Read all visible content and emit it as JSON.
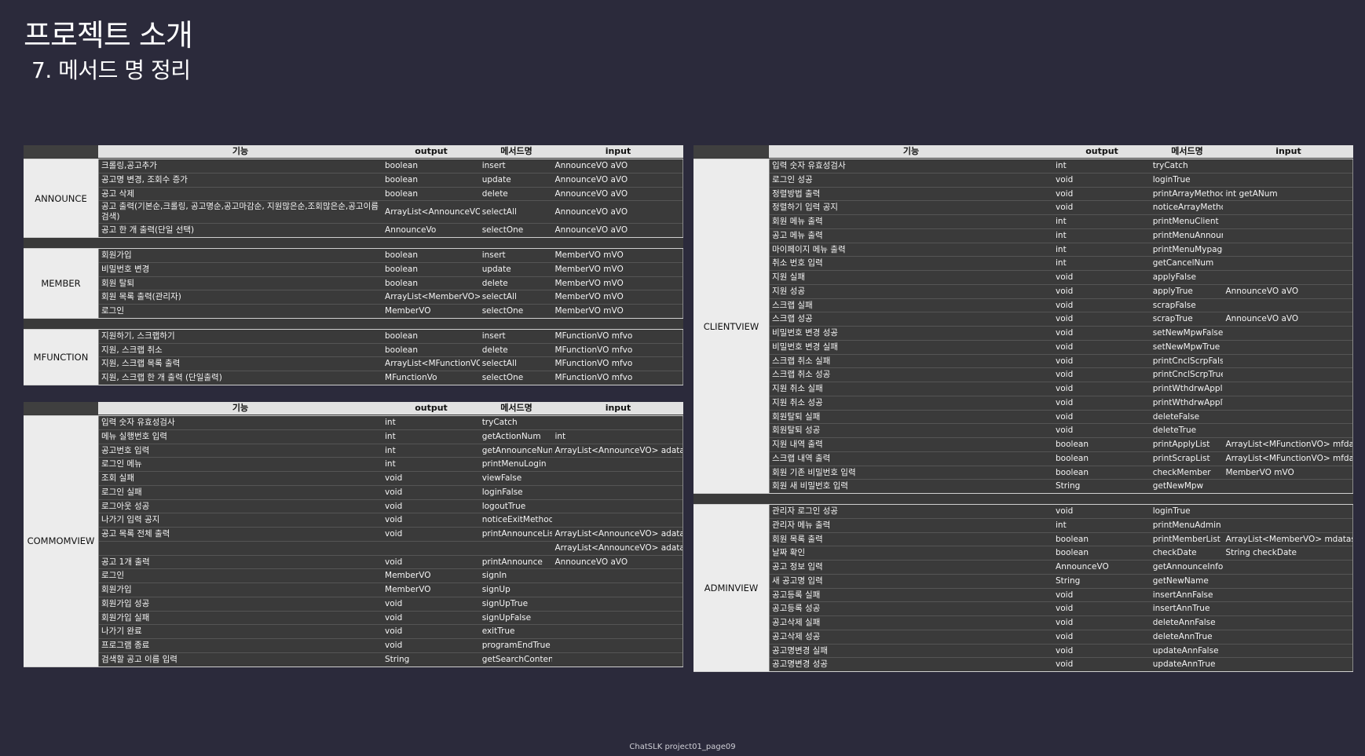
{
  "title": "프로젝트 소개",
  "subtitle": "7. 메서드 명 정리",
  "footer": "ChatSLK project01_page09",
  "headers": {
    "feature": "기능",
    "output": "output",
    "method": "메서드명",
    "input": "input"
  },
  "table1": {
    "announce": {
      "label": "ANNOUNCE",
      "rows": [
        {
          "feature": "크롤링,공고추가",
          "output": "boolean",
          "method": "insert",
          "input": "AnnounceVO aVO"
        },
        {
          "feature": "공고명 변경, 조회수 증가",
          "output": "boolean",
          "method": "update",
          "input": "AnnounceVO aVO"
        },
        {
          "feature": "공고 삭제",
          "output": "boolean",
          "method": "delete",
          "input": "AnnounceVO aVO"
        },
        {
          "feature": "공고 출력(기본순,크롤링, 공고명순,공고마감순, 지원많은순,조회많은순,공고이름검색)",
          "output": "ArrayList<AnnounceVO>",
          "method": "selectAll",
          "input": "AnnounceVO aVO"
        },
        {
          "feature": "공고 한 개 출력(단일 선택)",
          "output": "AnnounceVo",
          "method": "selectOne",
          "input": "AnnounceVO aVO"
        }
      ]
    },
    "member": {
      "label": "MEMBER",
      "rows": [
        {
          "feature": "회원가입",
          "output": "boolean",
          "method": "insert",
          "input": "MemberVO mVO"
        },
        {
          "feature": "비밀번호 변경",
          "output": "boolean",
          "method": "update",
          "input": "MemberVO mVO"
        },
        {
          "feature": "회원 탈퇴",
          "output": "boolean",
          "method": "delete",
          "input": "MemberVO mVO"
        },
        {
          "feature": "회원 목록 출력(관리자)",
          "output": "ArrayList<MemberVO>",
          "method": "selectAll",
          "input": "MemberVO mVO"
        },
        {
          "feature": "로그인",
          "output": "MemberVO",
          "method": "selectOne",
          "input": "MemberVO mVO"
        }
      ]
    },
    "mfunction": {
      "label": "MFUNCTION",
      "rows": [
        {
          "feature": "지원하기, 스크랩하기",
          "output": "boolean",
          "method": "insert",
          "input": "MFunctionVO mfvo"
        },
        {
          "feature": "지원, 스크랩 취소",
          "output": "boolean",
          "method": "delete",
          "input": "MFunctionVO mfvo"
        },
        {
          "feature": "지원, 스크랩 목록 출력",
          "output": "ArrayList<MFunctionVO>",
          "method": "selectAll",
          "input": "MFunctionVO mfvo"
        },
        {
          "feature": "지원, 스크랩 한 개 출력 (단일출력)",
          "output": "MFunctionVo",
          "method": "selectOne",
          "input": "MFunctionVO mfvo"
        }
      ]
    }
  },
  "table2": {
    "commomview": {
      "label": "COMMOMVIEW",
      "rows": [
        {
          "feature": "입력 숫자 유효성검사",
          "output": "int",
          "method": "tryCatch",
          "input": ""
        },
        {
          "feature": "메뉴 실행번호 입력",
          "output": "int",
          "method": "getActionNum",
          "input": "int"
        },
        {
          "feature": "공고번호 입력",
          "output": "int",
          "method": "getAnnounceNum",
          "input": "ArrayList<AnnounceVO> adatas"
        },
        {
          "feature": "로그인 메뉴",
          "output": "int",
          "method": "printMenuLogin",
          "input": ""
        },
        {
          "feature": "조회 실패",
          "output": "void",
          "method": "viewFalse",
          "input": ""
        },
        {
          "feature": "로그인 실패",
          "output": "void",
          "method": "loginFalse",
          "input": ""
        },
        {
          "feature": "로그아웃 성공",
          "output": "void",
          "method": "logoutTrue",
          "input": ""
        },
        {
          "feature": "나가기 입력 공지",
          "output": "void",
          "method": "noticeExitMethod",
          "input": ""
        },
        {
          "feature": "공고 목록 전체 출력",
          "output": "void",
          "method": "printAnnounceList",
          "input": "ArrayList<AnnounceVO> adatas"
        },
        {
          "feature": "",
          "output": "",
          "method": "",
          "input": "ArrayList<AnnounceVO> adatas, int"
        },
        {
          "feature": "공고 1개 출력",
          "output": "void",
          "method": "printAnnounce",
          "input": "AnnounceVO aVO"
        },
        {
          "feature": "로그인",
          "output": "MemberVO",
          "method": "signIn",
          "input": ""
        },
        {
          "feature": "회원가입",
          "output": "MemberVO",
          "method": "signUp",
          "input": ""
        },
        {
          "feature": "회원가입 성공",
          "output": "void",
          "method": "signUpTrue",
          "input": ""
        },
        {
          "feature": "회원가입 실패",
          "output": "void",
          "method": "signUpFalse",
          "input": ""
        },
        {
          "feature": "나가기 완료",
          "output": "void",
          "method": "exitTrue",
          "input": ""
        },
        {
          "feature": "프로그램 종료",
          "output": "void",
          "method": "programEndTrue",
          "input": ""
        },
        {
          "feature": "검색할 공고 이름 입력",
          "output": "String",
          "method": "getSearchContent",
          "input": ""
        }
      ]
    }
  },
  "table3": {
    "clientview": {
      "label": "CLIENTVIEW",
      "rows": [
        {
          "feature": "입력 숫자 유효성검사",
          "output": "int",
          "method": "tryCatch",
          "input": ""
        },
        {
          "feature": "로그인 성공",
          "output": "void",
          "method": "loginTrue",
          "input": ""
        },
        {
          "feature": "정렬방법 출력",
          "output": "void",
          "method": "printArrayMethod",
          "input": "int getANum"
        },
        {
          "feature": "정렬하기 입력 공지",
          "output": "void",
          "method": "noticeArrayMethod",
          "input": ""
        },
        {
          "feature": "회원 메뉴 출력",
          "output": "int",
          "method": "printMenuClient",
          "input": ""
        },
        {
          "feature": "공고 메뉴 출력",
          "output": "int",
          "method": "printMenuAnnounce",
          "input": ""
        },
        {
          "feature": "마이페이지 메뉴 출력",
          "output": "int",
          "method": "printMenuMypage",
          "input": ""
        },
        {
          "feature": "취소 번호 입력",
          "output": "int",
          "method": "getCancelNum",
          "input": ""
        },
        {
          "feature": "지원 실패",
          "output": "void",
          "method": "applyFalse",
          "input": ""
        },
        {
          "feature": "지원 성공",
          "output": "void",
          "method": "applyTrue",
          "input": "AnnounceVO aVO"
        },
        {
          "feature": "스크랩 실패",
          "output": "void",
          "method": "scrapFalse",
          "input": ""
        },
        {
          "feature": "스크랩 성공",
          "output": "void",
          "method": "scrapTrue",
          "input": "AnnounceVO aVO"
        },
        {
          "feature": "비밀번호 변경 성공",
          "output": "void",
          "method": "setNewMpwFalse",
          "input": ""
        },
        {
          "feature": "비밀번호 변경 실패",
          "output": "void",
          "method": "setNewMpwTrue",
          "input": ""
        },
        {
          "feature": "스크랩 취소 실패",
          "output": "void",
          "method": "printCnclScrpFalse",
          "input": ""
        },
        {
          "feature": "스크랩 취소 성공",
          "output": "void",
          "method": "printCnclScrpTrue",
          "input": ""
        },
        {
          "feature": "지원 취소 실패",
          "output": "void",
          "method": "printWthdrwApplFalse",
          "input": ""
        },
        {
          "feature": "지원 취소 성공",
          "output": "void",
          "method": "printWthdrwApplTrue",
          "input": ""
        },
        {
          "feature": "회원탈퇴 실패",
          "output": "void",
          "method": "deleteFalse",
          "input": ""
        },
        {
          "feature": "회원탈퇴 성공",
          "output": "void",
          "method": "deleteTrue",
          "input": ""
        },
        {
          "feature": "지원 내역 출력",
          "output": "boolean",
          "method": "printApplyList",
          "input": "ArrayList<MFunctionVO> mfdatas"
        },
        {
          "feature": "스크랩 내역 출력",
          "output": "boolean",
          "method": "printScrapList",
          "input": "ArrayList<MFunctionVO> mfdatas"
        },
        {
          "feature": "회원 기존 비밀번호 입력",
          "output": "boolean",
          "method": "checkMember",
          "input": "MemberVO mVO"
        },
        {
          "feature": "회원 새 비밀번호 입력",
          "output": "String",
          "method": "getNewMpw",
          "input": ""
        }
      ]
    },
    "adminview": {
      "label": "ADMINVIEW",
      "rows": [
        {
          "feature": "관리자 로그인 성공",
          "output": "void",
          "method": "loginTrue",
          "input": ""
        },
        {
          "feature": "관리자 메뉴 출력",
          "output": "int",
          "method": "printMenuAdmin",
          "input": ""
        },
        {
          "feature": "회원 목록 출력",
          "output": "boolean",
          "method": "printMemberList",
          "input": "ArrayList<MemberVO> mdatas"
        },
        {
          "feature": "날짜 확인",
          "output": "boolean",
          "method": "checkDate",
          "input": "String checkDate"
        },
        {
          "feature": "공고 정보 입력",
          "output": "AnnounceVO",
          "method": "getAnnounceInfo",
          "input": ""
        },
        {
          "feature": "새 공고명 입력",
          "output": "String",
          "method": "getNewName",
          "input": ""
        },
        {
          "feature": "공고등록 실패",
          "output": "void",
          "method": "insertAnnFalse",
          "input": ""
        },
        {
          "feature": "공고등록 성공",
          "output": "void",
          "method": "insertAnnTrue",
          "input": ""
        },
        {
          "feature": "공고삭제 실패",
          "output": "void",
          "method": "deleteAnnFalse",
          "input": ""
        },
        {
          "feature": "공고삭제 성공",
          "output": "void",
          "method": "deleteAnnTrue",
          "input": ""
        },
        {
          "feature": "공고명변경 실패",
          "output": "void",
          "method": "updateAnnFalse",
          "input": ""
        },
        {
          "feature": "공고명변경 성공",
          "output": "void",
          "method": "updateAnnTrue",
          "input": ""
        }
      ]
    }
  }
}
